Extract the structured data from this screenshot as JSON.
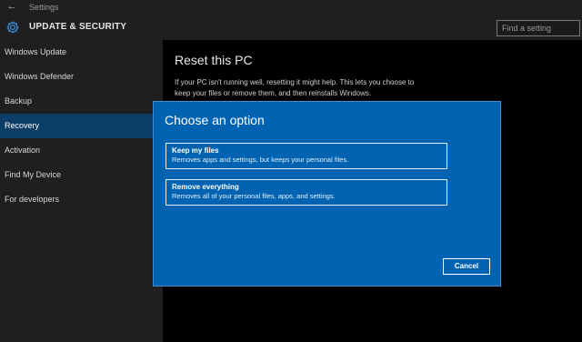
{
  "titlebar": {
    "back_icon": "back-arrow-icon",
    "app_title": "Settings"
  },
  "header": {
    "icon": "gear-icon",
    "title": "UPDATE & SECURITY",
    "search_placeholder": "Find a setting"
  },
  "sidebar": {
    "items": [
      {
        "label": "Windows Update",
        "active": false
      },
      {
        "label": "Windows Defender",
        "active": false
      },
      {
        "label": "Backup",
        "active": false
      },
      {
        "label": "Recovery",
        "active": true
      },
      {
        "label": "Activation",
        "active": false
      },
      {
        "label": "Find My Device",
        "active": false
      },
      {
        "label": "For developers",
        "active": false
      }
    ]
  },
  "main": {
    "title": "Reset this PC",
    "description": "If your PC isn't running well, resetting it might help. This lets you choose to keep your files or remove them, and then reinstalls Windows."
  },
  "dialog": {
    "title": "Choose an option",
    "options": [
      {
        "title": "Keep my files",
        "description": "Removes apps and settings, but keeps your personal files."
      },
      {
        "title": "Remove everything",
        "description": "Removes all of your personal files, apps, and settings."
      }
    ],
    "cancel_label": "Cancel"
  },
  "colors": {
    "dialog_background": "#0063b1",
    "active_sidebar": "#0c3d66",
    "chrome_background": "#1f1f1f",
    "accent_icon": "#3a8fd8"
  }
}
